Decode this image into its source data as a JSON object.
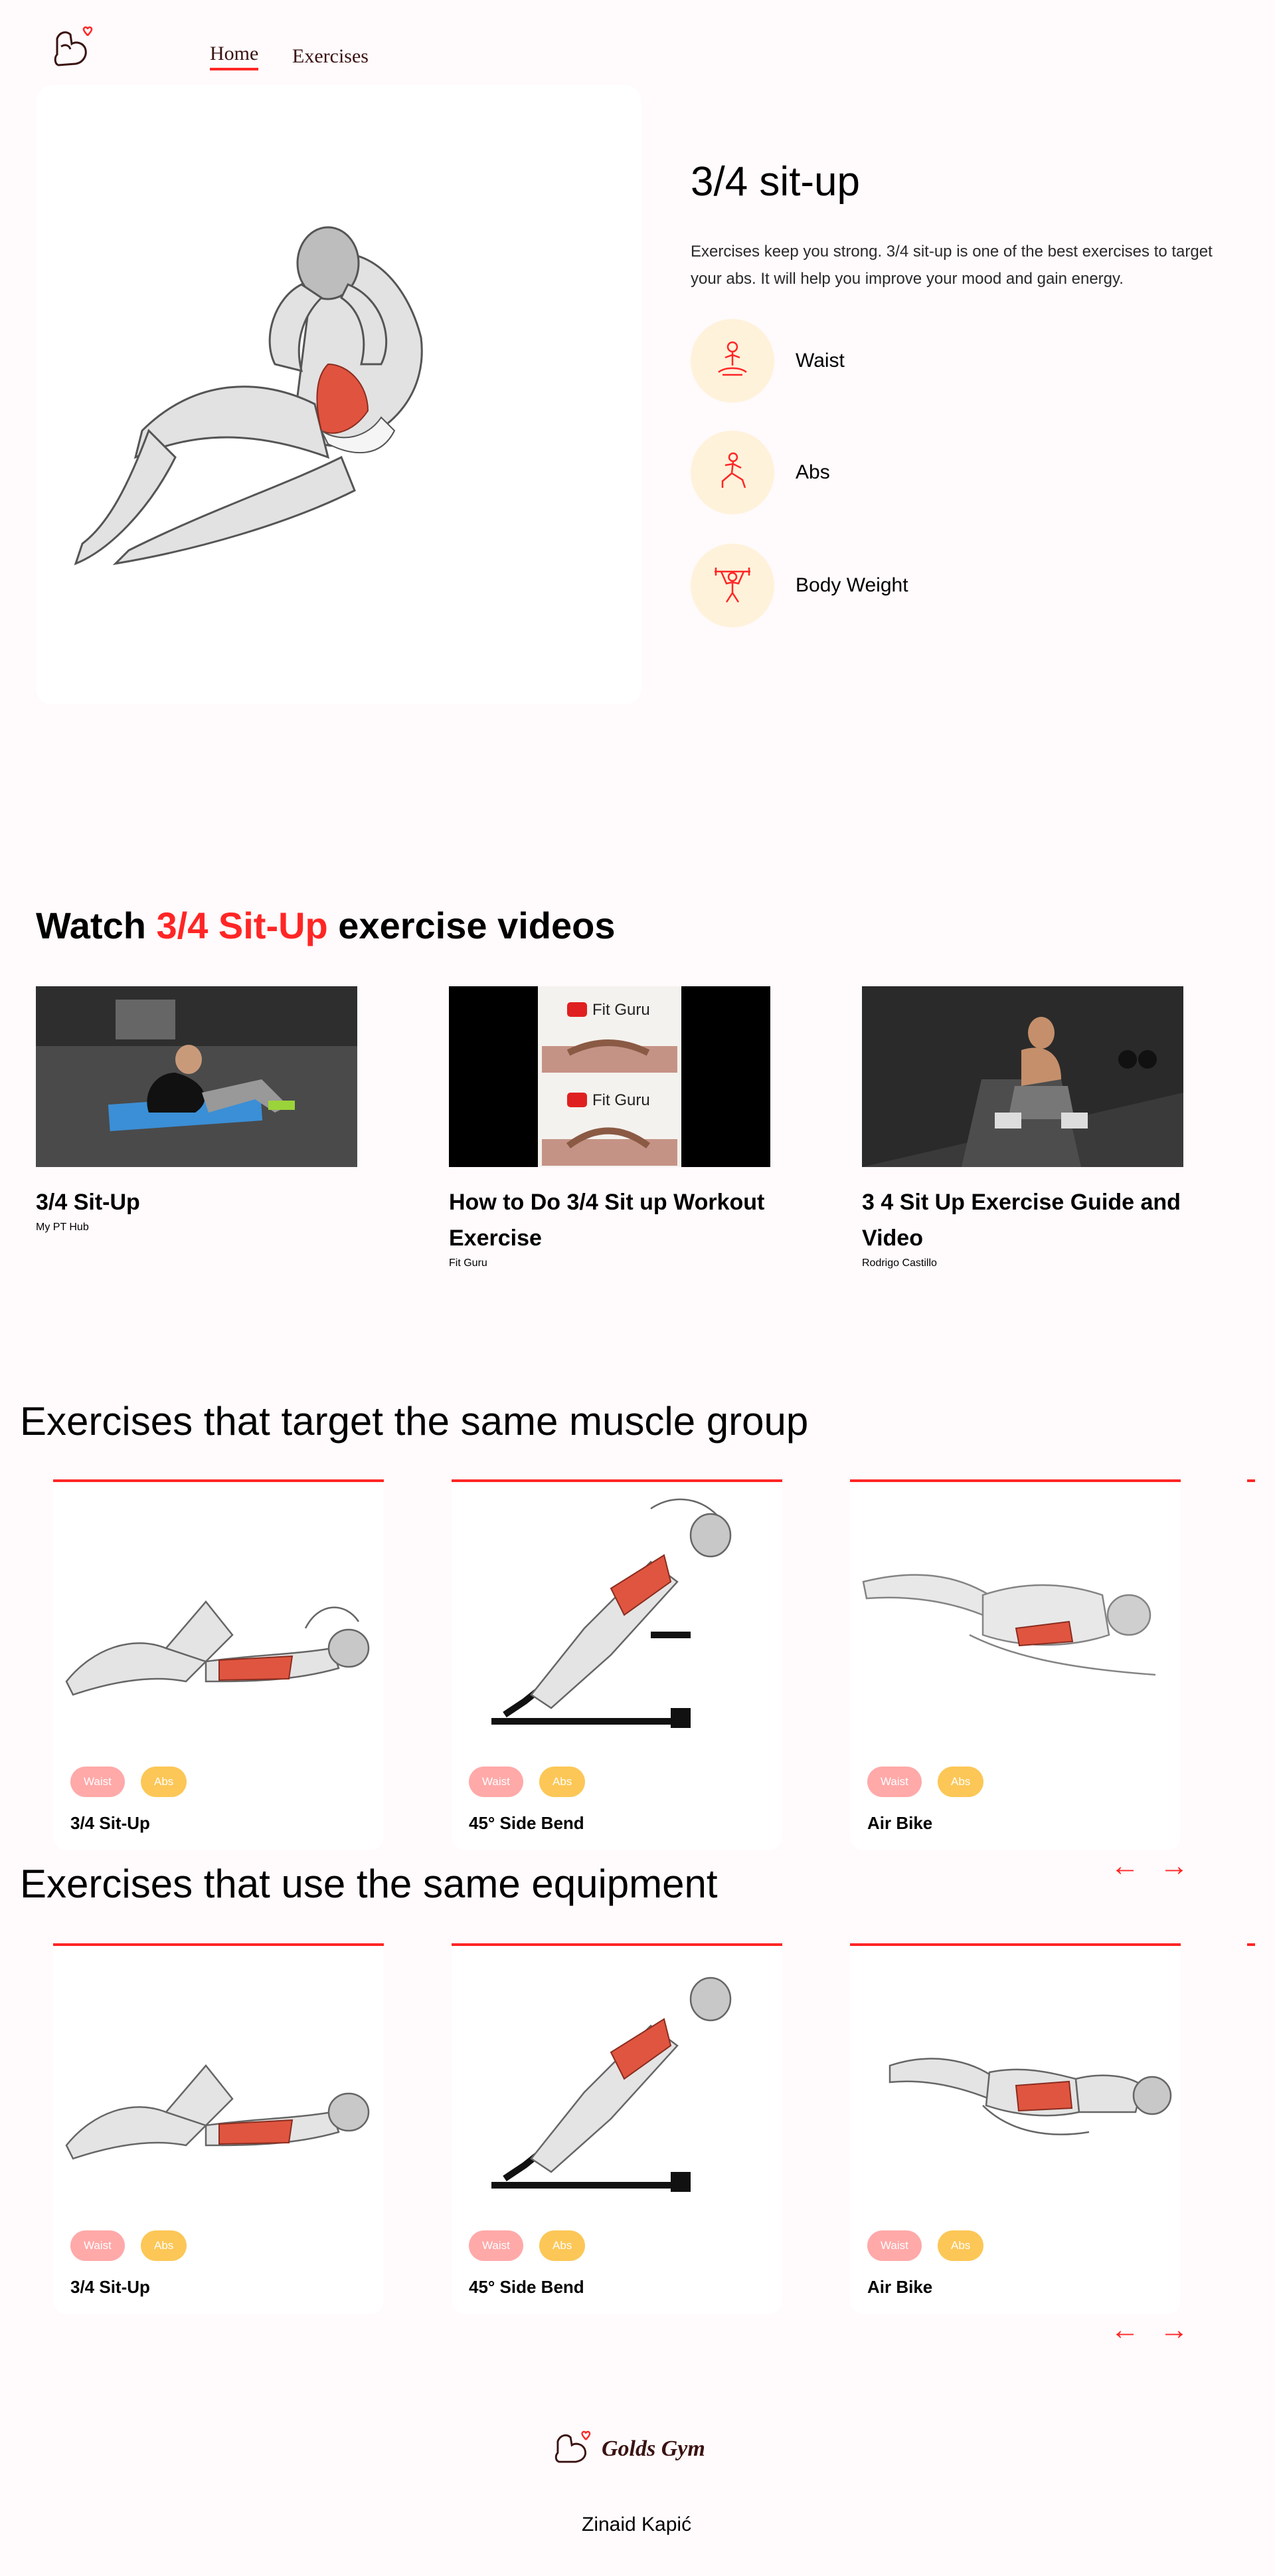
{
  "nav": {
    "links": [
      "Home",
      "Exercises"
    ],
    "active": "Home"
  },
  "hero": {
    "title": "3/4 sit-up",
    "description": "Exercises keep you strong. 3/4 sit-up is one of the best exercises to target your abs. It will help you improve your mood and gain energy.",
    "tags": [
      {
        "label": "Waist",
        "icon": "meditation-icon"
      },
      {
        "label": "Abs",
        "icon": "lunge-icon"
      },
      {
        "label": "Body Weight",
        "icon": "weightlifter-icon"
      }
    ]
  },
  "videos": {
    "heading_pre": "Watch ",
    "heading_accent": "3/4 Sit-Up",
    "heading_post": " exercise videos",
    "items": [
      {
        "title": "3/4 Sit-Up",
        "channel": "My PT Hub"
      },
      {
        "title": "How to Do 3/4 Sit up Workout Exercise",
        "channel": "Fit Guru",
        "thumb_text": "Fit Guru"
      },
      {
        "title": "3 4 Sit Up Exercise Guide and Video",
        "channel": "Rodrigo Castillo"
      }
    ]
  },
  "similar_target": {
    "heading": "Exercises that target the same muscle group",
    "cards": [
      {
        "name": "3/4 Sit-Up",
        "tags": [
          "Waist",
          "Abs"
        ]
      },
      {
        "name": "45° Side Bend",
        "tags": [
          "Waist",
          "Abs"
        ]
      },
      {
        "name": "Air Bike",
        "tags": [
          "Waist",
          "Abs"
        ]
      }
    ]
  },
  "similar_equipment": {
    "heading": "Exercises that use the same equipment",
    "cards": [
      {
        "name": "3/4 Sit-Up",
        "tags": [
          "Waist",
          "Abs"
        ]
      },
      {
        "name": "45° Side Bend",
        "tags": [
          "Waist",
          "Abs"
        ]
      },
      {
        "name": "Air Bike",
        "tags": [
          "Waist",
          "Abs"
        ]
      }
    ]
  },
  "arrows": {
    "left": "←",
    "right": "→"
  },
  "footer": {
    "brand": "Golds Gym",
    "author": "Zinaid Kapić"
  },
  "colors": {
    "accent": "#ff2625",
    "tag_bg": "#fff2db",
    "pill_pink": "#ffa9a9",
    "pill_yellow": "#fcc757",
    "background": "#fffafb"
  }
}
